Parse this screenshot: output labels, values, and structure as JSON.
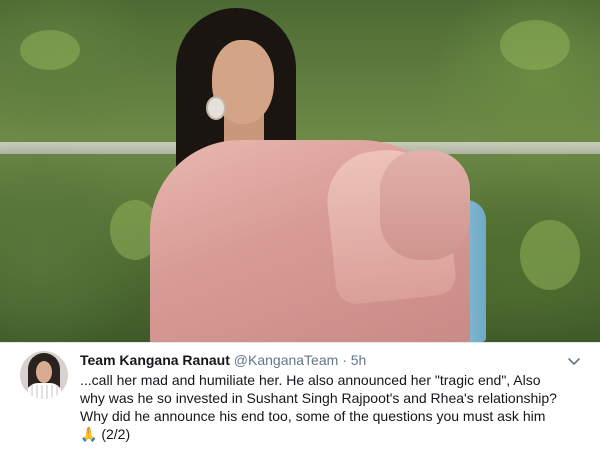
{
  "tweet": {
    "display_name": "Team Kangana Ranaut",
    "handle": "@KanganaTeam",
    "separator": "·",
    "time": "5h",
    "lines": [
      "...call her mad and humiliate her. He also announced her \"tragic end\",  Also",
      "why was he so invested in Sushant Singh Rajpoot's and Rhea's relationship?",
      "Why did he announce his end too, some of the questions you must ask him"
    ],
    "last_line_emoji": "🙏",
    "last_line_suffix": " (2/2)"
  },
  "icons": {
    "more": "chevron-down-icon",
    "avatar": "avatar"
  },
  "colors": {
    "name": "#14171a",
    "secondary": "#657786",
    "divider": "#e1e8ed"
  }
}
